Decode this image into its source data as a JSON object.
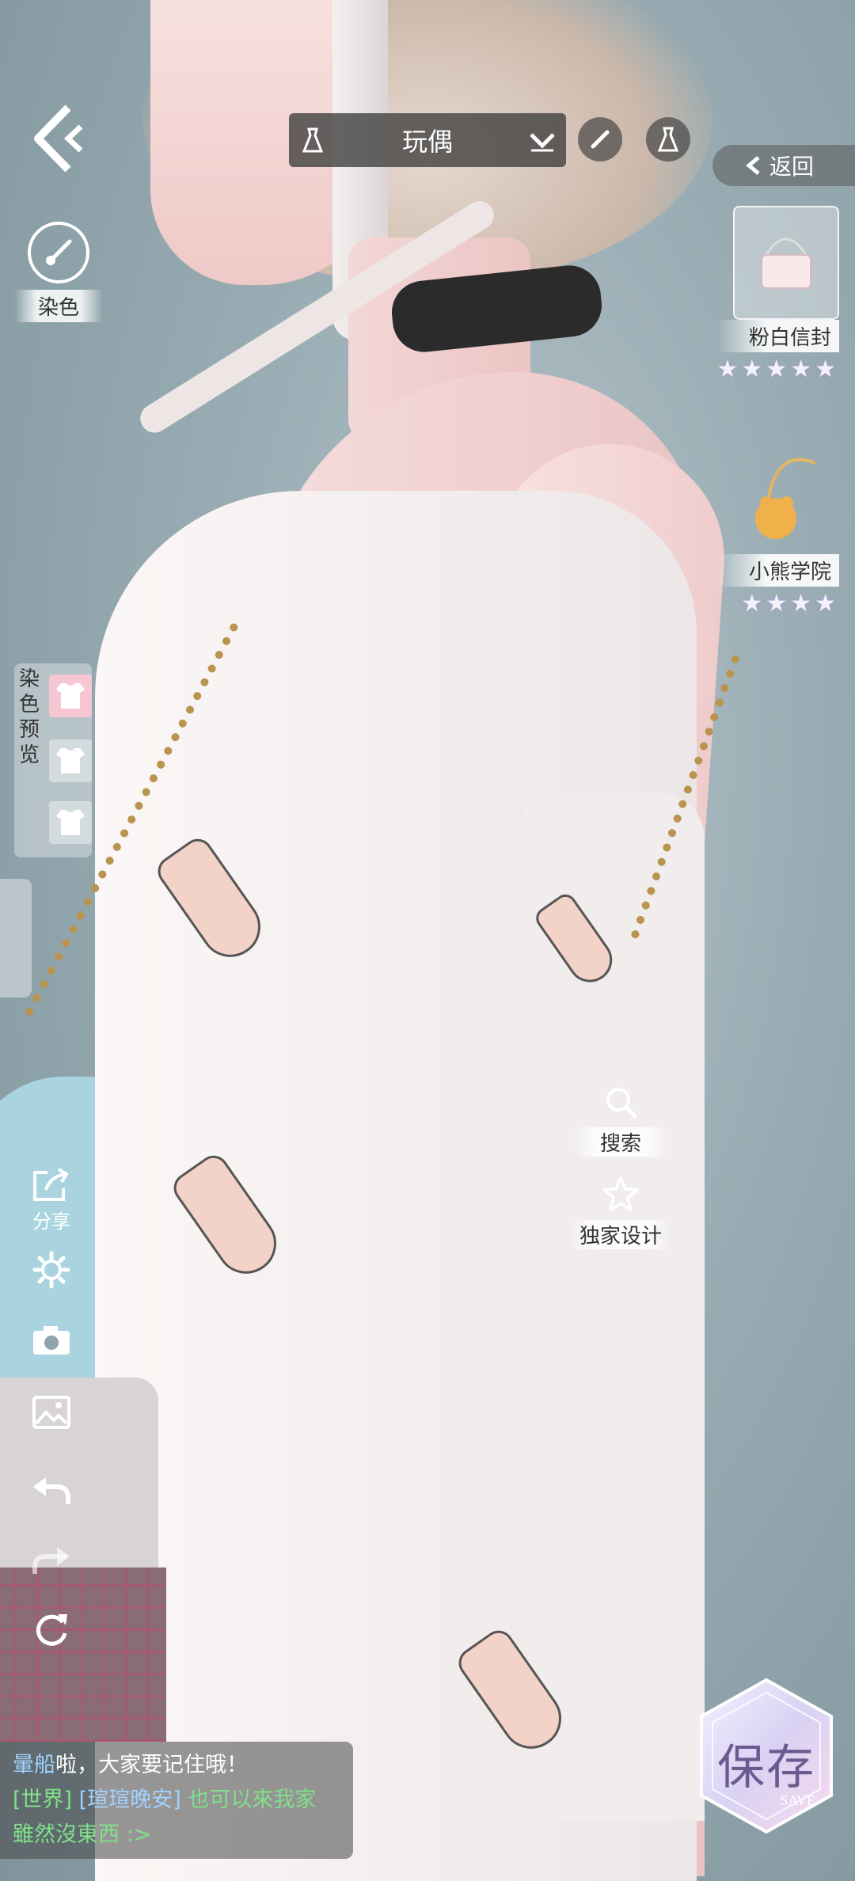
{
  "top_bar": {
    "title": "玩偶"
  },
  "left_panel": {
    "dye_label": "染色"
  },
  "return_button": {
    "label": "返回"
  },
  "items": [
    {
      "name": "粉白信封",
      "stars": "★★★★★"
    },
    {
      "name": "小熊学院",
      "stars": "★★★★"
    }
  ],
  "dye_preview": {
    "label": "染色预览"
  },
  "right_actions": {
    "search_label": "搜索",
    "exclusive_label": "独家设计"
  },
  "left_tools": {
    "share_label": "分享"
  },
  "chat": {
    "line1_name": "暈船",
    "line1_text": "啦，大家要记住哦！",
    "line2_channel": "[世界]",
    "line2_user": "[瑄瑄晚安]",
    "line2_text": "也可以來我家",
    "line3_text": "雖然沒東西 :>"
  },
  "save_button": {
    "label": "保存",
    "sub_label": "SAVE"
  },
  "colors": {
    "accent": "#6a5a8f",
    "chat_name": "#9fd3ff",
    "chat_world": "#7fe08a"
  }
}
